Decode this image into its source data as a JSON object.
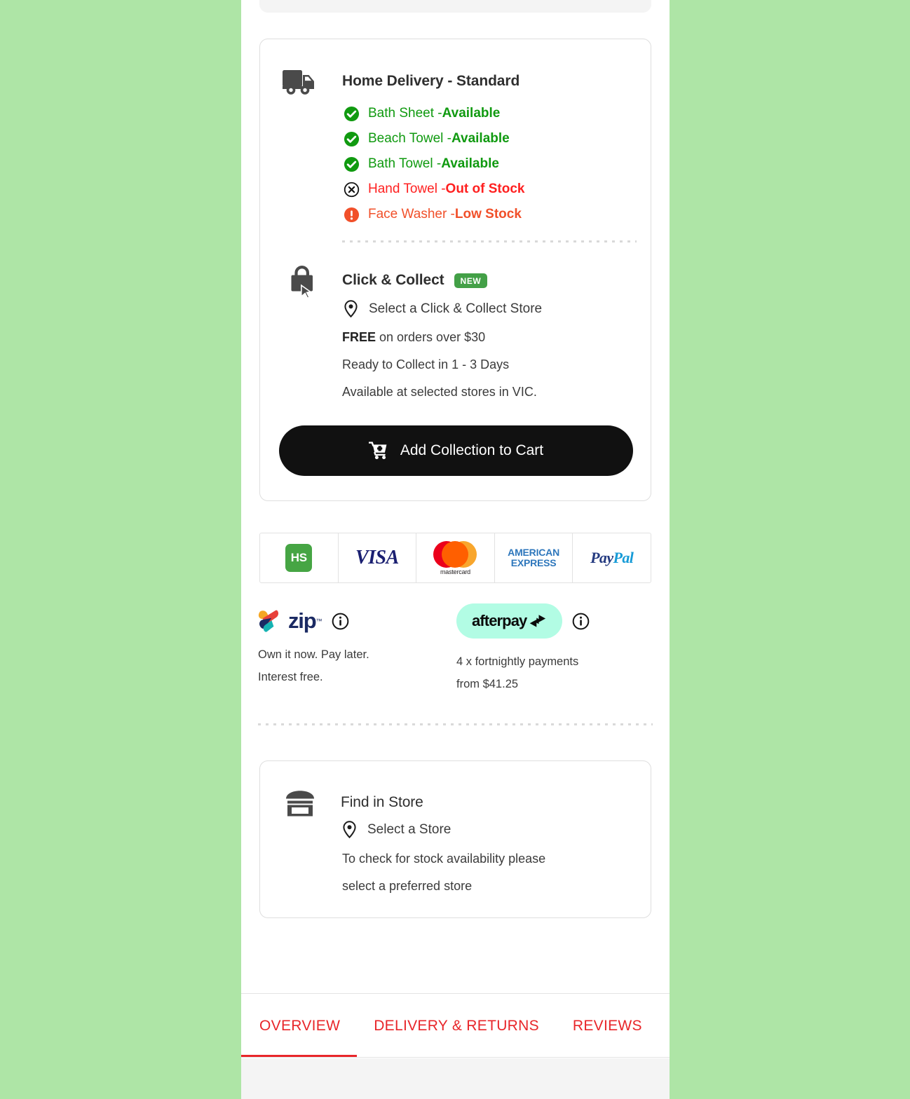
{
  "theme": {
    "page_background": "#aee5a6",
    "panel_background": "#ffffff",
    "accent_red": "#e8262a",
    "available_green": "#109a10",
    "out_of_stock_red": "#ff2020",
    "low_stock_orange": "#f1502a",
    "badge_green": "#43a047",
    "button_black": "#111111",
    "afterpay_mint": "#b2fce4"
  },
  "delivery": {
    "icon": "truck-icon",
    "title": "Home Delivery - Standard",
    "items": [
      {
        "name": "Bath Sheet - ",
        "status": "Available",
        "state": "available",
        "icon": "check-circle-icon"
      },
      {
        "name": "Beach Towel - ",
        "status": "Available",
        "state": "available",
        "icon": "check-circle-icon"
      },
      {
        "name": "Bath Towel - ",
        "status": "Available",
        "state": "available",
        "icon": "check-circle-icon"
      },
      {
        "name": "Hand Towel - ",
        "status": "Out of Stock",
        "state": "out",
        "icon": "x-circle-icon"
      },
      {
        "name": "Face Washer - ",
        "status": "Low Stock",
        "state": "low",
        "icon": "exclamation-circle-icon"
      }
    ]
  },
  "click_collect": {
    "icon": "shopping-bag-cursor-icon",
    "title": "Click & Collect",
    "badge": "NEW",
    "store_selector": "Select a Click & Collect Store",
    "free_prefix": "FREE",
    "free_rest": " on orders over $30",
    "ready": "Ready to Collect in 1 - 3 Days",
    "availability": "Available at selected stores in VIC.",
    "cta": "Add Collection to Cart"
  },
  "payments": {
    "methods": [
      {
        "name": "HS",
        "short": "HS"
      },
      {
        "name": "VISA",
        "short": "VISA"
      },
      {
        "name": "mastercard",
        "short": "mastercard"
      },
      {
        "name": "AMERICAN EXPRESS",
        "line1": "AMERICAN",
        "line2": "EXPRESS"
      },
      {
        "name": "PayPal",
        "part1": "Pay",
        "part2": "Pal"
      }
    ]
  },
  "bnpl": {
    "zip": {
      "brand": "zip",
      "trademark": "™",
      "line1": "Own it now. Pay later.",
      "line2": "Interest free."
    },
    "afterpay": {
      "brand": "afterpay",
      "line1": "4 x fortnightly payments",
      "line2": "from $41.25"
    }
  },
  "find_in_store": {
    "icon": "storefront-icon",
    "title": "Find in Store",
    "store_selector": "Select a Store",
    "line1": "To check for stock availability please",
    "line2": "select a preferred store"
  },
  "tabs": {
    "items": [
      {
        "label": "OVERVIEW",
        "active": true
      },
      {
        "label": "DELIVERY & RETURNS",
        "active": false
      },
      {
        "label": "REVIEWS",
        "active": false
      }
    ]
  }
}
